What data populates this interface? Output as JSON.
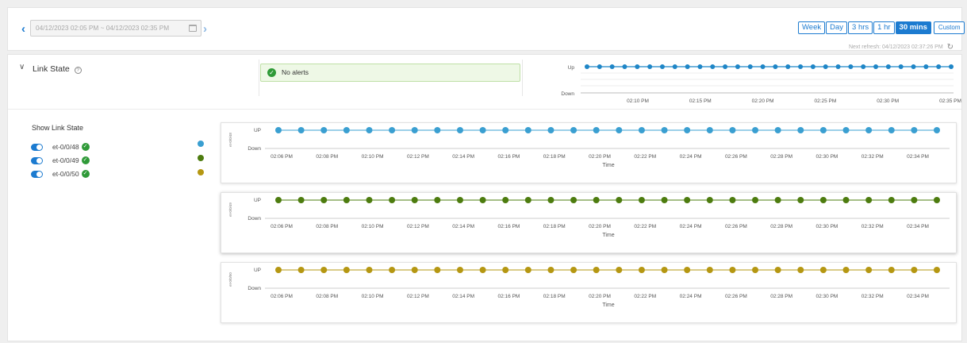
{
  "toolbar": {
    "date_range": "04/12/2023 02:05 PM ~ 04/12/2023 02:35 PM",
    "range_buttons": [
      {
        "label": "Week",
        "active": false
      },
      {
        "label": "Day",
        "active": false
      },
      {
        "label": "3 hrs",
        "active": false
      },
      {
        "label": "1 hr",
        "active": false
      },
      {
        "label": "30 mins",
        "active": true
      }
    ],
    "custom_label": "Custom",
    "next_refresh": "Next refresh: 04/12/2023 02:37:26 PM"
  },
  "panel": {
    "title": "Link State",
    "help_icon": "?",
    "alert_text": "No alerts"
  },
  "legend": {
    "title": "Show Link State",
    "items": [
      {
        "label": "et-0/0/48",
        "enabled": true,
        "color": "#3a9fd1"
      },
      {
        "label": "et-0/0/49",
        "enabled": true,
        "color": "#4d7c0f"
      },
      {
        "label": "et-0/0/50",
        "enabled": true,
        "color": "#b59712"
      }
    ]
  },
  "colors": {
    "accent": "#1c7bd0",
    "ok": "#2f9a38",
    "summary_line": "#1f86c7"
  },
  "chart_data": [
    {
      "type": "line",
      "title": "",
      "ylabels": [
        "Up",
        "Down"
      ],
      "x_ticks": [
        "02:10 PM",
        "02:15 PM",
        "02:20 PM",
        "02:25 PM",
        "02:30 PM",
        "02:35 PM"
      ],
      "series": [
        {
          "color": "#1f86c7",
          "points": 30,
          "state": "Up"
        }
      ]
    },
    {
      "type": "line",
      "ylabels": [
        "UP",
        "Down"
      ],
      "y_axis_label": "et-0/0/48",
      "xlabel": "Time",
      "x_ticks": [
        "02:06 PM",
        "02:08 PM",
        "02:10 PM",
        "02:12 PM",
        "02:14 PM",
        "02:16 PM",
        "02:18 PM",
        "02:20 PM",
        "02:22 PM",
        "02:24 PM",
        "02:26 PM",
        "02:28 PM",
        "02:30 PM",
        "02:32 PM",
        "02:34 PM"
      ],
      "series": [
        {
          "color": "#3a9fd1",
          "points": 30,
          "state": "UP"
        }
      ]
    },
    {
      "type": "line",
      "ylabels": [
        "UP",
        "Down"
      ],
      "y_axis_label": "et-0/0/49",
      "xlabel": "Time",
      "x_ticks": [
        "02:06 PM",
        "02:08 PM",
        "02:10 PM",
        "02:12 PM",
        "02:14 PM",
        "02:16 PM",
        "02:18 PM",
        "02:20 PM",
        "02:22 PM",
        "02:24 PM",
        "02:26 PM",
        "02:28 PM",
        "02:30 PM",
        "02:32 PM",
        "02:34 PM"
      ],
      "series": [
        {
          "color": "#4d7c0f",
          "points": 30,
          "state": "UP"
        }
      ]
    },
    {
      "type": "line",
      "ylabels": [
        "UP",
        "Down"
      ],
      "y_axis_label": "et-0/0/50",
      "xlabel": "Time",
      "x_ticks": [
        "02:06 PM",
        "02:08 PM",
        "02:10 PM",
        "02:12 PM",
        "02:14 PM",
        "02:16 PM",
        "02:18 PM",
        "02:20 PM",
        "02:22 PM",
        "02:24 PM",
        "02:26 PM",
        "02:28 PM",
        "02:30 PM",
        "02:32 PM",
        "02:34 PM"
      ],
      "series": [
        {
          "color": "#b59712",
          "points": 30,
          "state": "UP"
        }
      ]
    }
  ]
}
